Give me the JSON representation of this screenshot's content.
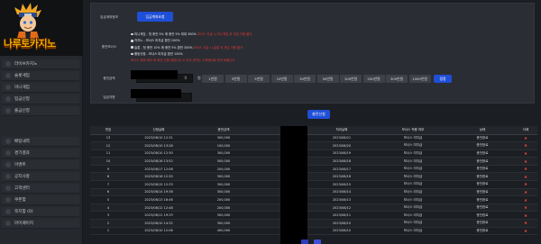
{
  "brand": {
    "name": "나루토카지노"
  },
  "sidebar": {
    "group1": [
      {
        "icon": "tv-icon",
        "label": "라이브카지노"
      },
      {
        "icon": "slot-icon",
        "label": "슬롯게임"
      },
      {
        "icon": "game-icon",
        "label": "미니게임"
      },
      {
        "icon": "deposit-icon",
        "label": "입금신청"
      },
      {
        "icon": "withdraw-icon",
        "label": "출금신청"
      }
    ],
    "group2": [
      {
        "icon": "betting-icon",
        "label": "배팅내역"
      },
      {
        "icon": "result-icon",
        "label": "경기결과"
      },
      {
        "icon": "event-icon",
        "label": "이벤트"
      },
      {
        "icon": "notice-icon",
        "label": "공지사항"
      },
      {
        "icon": "support-icon",
        "label": "고객센터"
      },
      {
        "icon": "coupon-icon",
        "label": "쿠폰함"
      },
      {
        "icon": "message-icon",
        "label": "쪽지함 (0)"
      },
      {
        "icon": "user-icon",
        "label": "마이페이지"
      }
    ]
  },
  "form": {
    "account_label": "입금계좌정보",
    "account_button": "입금계좌요청",
    "notice_label": "충전보너스",
    "notices": [
      {
        "white": "미니게임 - 첫 충전 5% 매 충전 5% 최대 300%",
        "red": " 보너스 지급 시 미니게임 외 게임 이용 불가"
      },
      {
        "white": "카지노 - 보너스 미지급 환전 100%",
        "red": ""
      },
      {
        "white": "슬롯 - 첫 충전 10% 매 충전 5% 환전 300%",
        "red": " 보너스 지급 시 슬롯 외 게임 이용 불가"
      },
      {
        "white": "롤링규정 - 보너스 미지급 환전 100%",
        "red": ""
      },
      {
        "white": "",
        "red": "보너스 정보 확인 후 충전 신청 바랍니다 ※ 추가 문의는 고객센터로 문의 바랍니다"
      }
    ],
    "amount_label": "충전금액",
    "amount_value": "0",
    "amount_unit": "원",
    "amount_buttons": [
      "1만원",
      "3만원",
      "5만원",
      "10만원",
      "30만원",
      "50만원",
      "100만원",
      "200만원",
      "300만원",
      "1000만원"
    ],
    "reset_button": "정정",
    "password_label": "입금자명",
    "apply_button": "충전신청"
  },
  "table": {
    "headers": [
      "번호",
      "신청날짜",
      "충전금액",
      "",
      "처리날짜",
      "보너스 적용 여부",
      "상태",
      "삭제"
    ],
    "rows": [
      [
        "13",
        "2023/08/10 12:31",
        "300,000",
        "",
        "2023/08/21",
        "보너스 미지급",
        "충전완료"
      ],
      [
        "12",
        "2023/08/10 13:28",
        "100,000",
        "",
        "2023/08/20",
        "보너스 미지급",
        "충전완료"
      ],
      [
        "11",
        "2023/08/10 12:30",
        "300,000",
        "",
        "2023/08/19",
        "보너스 미지급",
        "충전완료"
      ],
      [
        "10",
        "2023/08/16 13:52",
        "500,000",
        "",
        "2023/08/18",
        "보너스 미지급",
        "충전완료"
      ],
      [
        "9",
        "2023/08/17 12:08",
        "200,000",
        "",
        "2023/08/17",
        "보너스 미지급",
        "충전완료"
      ],
      [
        "8",
        "2023/08/16 12:30",
        "300,000",
        "",
        "2023/08/16",
        "보너스 미지급",
        "충전완료"
      ],
      [
        "7",
        "2023/08/15 12:33",
        "300,000",
        "",
        "2023/08/15",
        "보너스 미지급",
        "충전완료"
      ],
      [
        "6",
        "2023/08/14 19:38",
        "300,000",
        "",
        "2023/08/14",
        "보너스 미지급",
        "충전완료"
      ],
      [
        "5",
        "2023/08/13 16:46",
        "200,000",
        "",
        "2023/08/13",
        "보너스 미지급",
        "충전완료"
      ],
      [
        "4",
        "2023/08/12 12:48",
        "200,000",
        "",
        "2023/08/12",
        "보너스 미지급",
        "충전완료"
      ],
      [
        "3",
        "2023/08/11 19:33",
        "300,000",
        "",
        "2023/08/11",
        "보너스 미지급",
        "충전완료"
      ],
      [
        "2",
        "2023/08/10 14:32",
        "300,000",
        "",
        "2023/08/10",
        "보너스 미지급",
        "충전완료"
      ],
      [
        "1",
        "2023/08/10 12:06",
        "400,000",
        "",
        "2023/08/10",
        "보너스 미지급",
        "충전완료"
      ]
    ],
    "delete_icon": "close-icon",
    "delete_glyph": "✖"
  },
  "colors": {
    "accent": "#1f4fd6",
    "danger": "#e23a3a",
    "brand": "#f4a900"
  }
}
